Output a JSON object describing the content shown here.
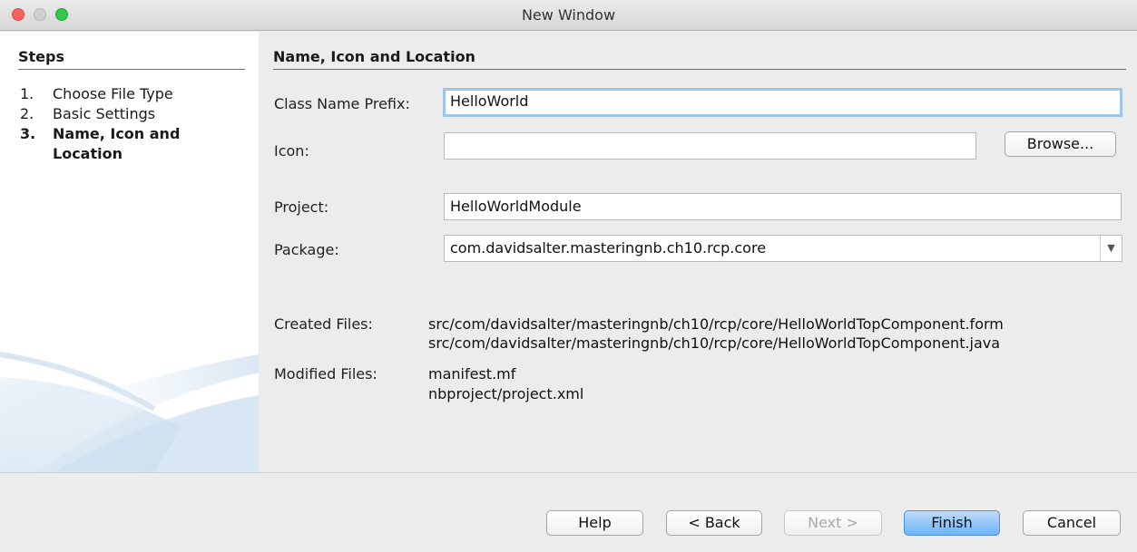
{
  "window": {
    "title": "New Window"
  },
  "steps": {
    "heading": "Steps",
    "items": [
      {
        "num": "1.",
        "label": "Choose File Type"
      },
      {
        "num": "2.",
        "label": "Basic Settings"
      },
      {
        "num": "3.",
        "label": "Name, Icon and Location",
        "current": true
      }
    ]
  },
  "main": {
    "heading": "Name, Icon and Location",
    "class_name_prefix": {
      "label": "Class Name Prefix:",
      "value": "HelloWorld"
    },
    "icon": {
      "label": "Icon:",
      "value": "",
      "browse_label": "Browse..."
    },
    "project": {
      "label": "Project:",
      "value": "HelloWorldModule"
    },
    "package": {
      "label": "Package:",
      "value": "com.davidsalter.masteringnb.ch10.rcp.core"
    },
    "created_files": {
      "label": "Created Files:",
      "lines": [
        "src/com/davidsalter/masteringnb/ch10/rcp/core/HelloWorldTopComponent.form",
        "src/com/davidsalter/masteringnb/ch10/rcp/core/HelloWorldTopComponent.java"
      ]
    },
    "modified_files": {
      "label": "Modified Files:",
      "lines": [
        "manifest.mf",
        "nbproject/project.xml"
      ]
    }
  },
  "buttons": {
    "help": "Help",
    "back": "< Back",
    "next": "Next >",
    "finish": "Finish",
    "cancel": "Cancel"
  }
}
